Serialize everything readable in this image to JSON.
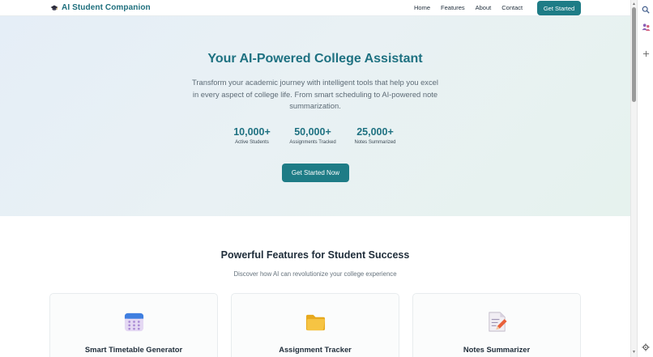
{
  "brand": {
    "name": "AI Student Companion",
    "icon": "graduation-cap-icon"
  },
  "nav": {
    "links": [
      "Home",
      "Features",
      "About",
      "Contact"
    ],
    "cta": "Get Started"
  },
  "hero": {
    "title": "Your AI-Powered College Assistant",
    "subtitle": "Transform your academic journey with intelligent tools that help you excel in every aspect of college life. From smart scheduling to AI-powered note summarization.",
    "stats": [
      {
        "value": "10,000+",
        "label": "Active Students"
      },
      {
        "value": "50,000+",
        "label": "Assignments Tracked"
      },
      {
        "value": "25,000+",
        "label": "Notes Summarized"
      }
    ],
    "button": "Get Started Now"
  },
  "features": {
    "title": "Powerful Features for Student Success",
    "subtitle": "Discover how AI can revolutionize your college experience",
    "cards": [
      {
        "title": "Smart Timetable Generator",
        "icon": "calendar-icon"
      },
      {
        "title": "Assignment Tracker",
        "icon": "folder-icon"
      },
      {
        "title": "Notes Summarizer",
        "icon": "memo-icon"
      }
    ]
  },
  "side_panel": {
    "icons": [
      "search-icon",
      "people-icon",
      "plus-icon",
      "settings-icon"
    ]
  },
  "colors": {
    "accent": "#1e7c86",
    "brand_text": "#1e7181",
    "hero_bg": "#e7f0f5"
  }
}
